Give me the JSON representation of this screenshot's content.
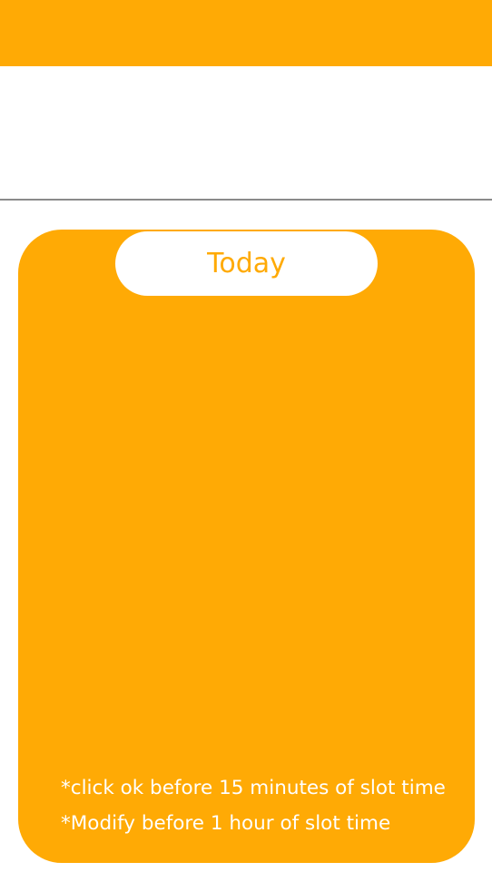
{
  "colors": {
    "accent": "#FFAA05",
    "background": "#FFFFFF",
    "divider": "#8A8A8A",
    "text_on_accent": "#FFFFFF"
  },
  "slot_card": {
    "day_label": "Today",
    "notes": [
      "*click ok before 15 minutes of slot time",
      "*Modify before 1 hour of slot time"
    ]
  }
}
